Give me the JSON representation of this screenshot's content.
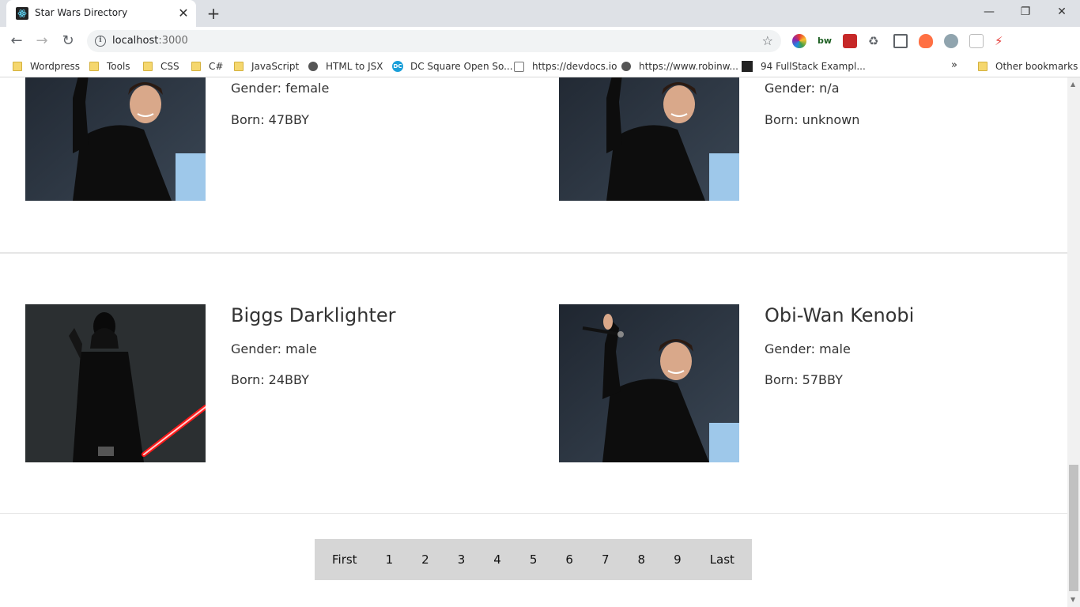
{
  "browser": {
    "tab_title": "Star Wars Directory",
    "url_host": "localhost",
    "url_port": ":3000",
    "bookmarks": [
      {
        "label": "Wordpress",
        "icon": "folder-icon"
      },
      {
        "label": "Tools",
        "icon": "folder-icon"
      },
      {
        "label": "CSS",
        "icon": "folder-icon"
      },
      {
        "label": "C#",
        "icon": "folder-icon"
      },
      {
        "label": "JavaScript",
        "icon": "folder-icon"
      },
      {
        "label": "HTML to JSX",
        "icon": "globe-icon"
      },
      {
        "label": "DC Square Open So...",
        "icon": "dc-icon"
      },
      {
        "label": "https://devdocs.io",
        "icon": "search-icon"
      },
      {
        "label": "https://www.robinw...",
        "icon": "globe-icon"
      },
      {
        "label": "94 FullStack Exampl...",
        "icon": "react-icon"
      }
    ],
    "bookmarks_more": "»",
    "other_bookmarks": "Other bookmarks"
  },
  "people": {
    "top_left": {
      "name": "",
      "gender": "Gender: female",
      "born": "Born: 47BBY",
      "image": "man-waving-photo"
    },
    "top_right": {
      "name": "",
      "gender": "Gender: n/a",
      "born": "Born: unknown",
      "image": "man-waving-photo"
    },
    "bottom_left": {
      "name": "Biggs Darklighter",
      "gender": "Gender: male",
      "born": "Born: 24BBY",
      "image": "darth-vader-photo"
    },
    "bottom_right": {
      "name": "Obi-Wan Kenobi",
      "gender": "Gender: male",
      "born": "Born: 57BBY",
      "image": "man-waving-microphone-photo"
    }
  },
  "pagination": {
    "first": "First",
    "pages": [
      "1",
      "2",
      "3",
      "4",
      "5",
      "6",
      "7",
      "8",
      "9"
    ],
    "last": "Last"
  }
}
